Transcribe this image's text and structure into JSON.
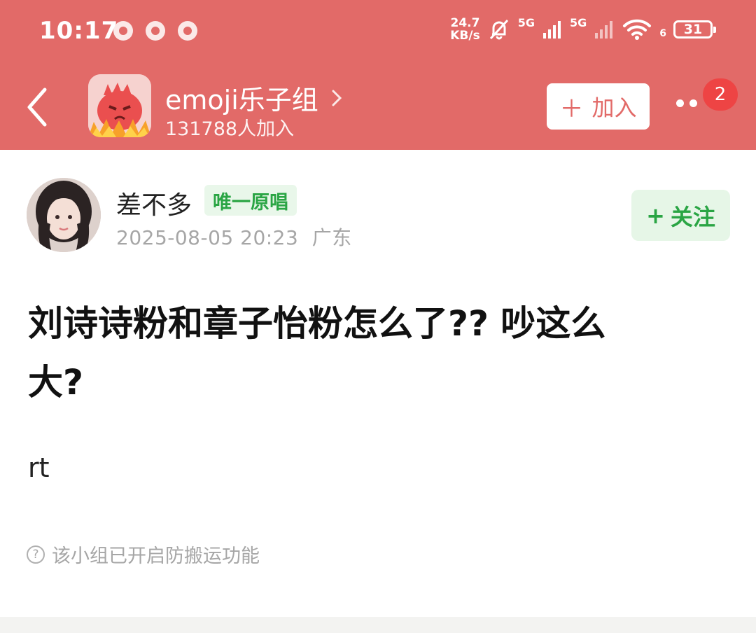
{
  "status_bar": {
    "time": "10:17",
    "net_speed_value": "24.7",
    "net_speed_unit": "KB/s",
    "sim1_label": "5G",
    "sim2_label": "5G",
    "wifi_label": "6",
    "battery": "31"
  },
  "group": {
    "name": "emoji乐子组",
    "members": "131788人加入",
    "join_label": "加入",
    "notification_count": "2"
  },
  "post": {
    "author_name": "差不多",
    "author_badge": "唯一原唱",
    "timestamp": "2025-08-05 20:23",
    "location": "广东",
    "follow_label": "关注",
    "title_line1": "刘诗诗粉和章子怡粉怎么了?? 吵这么",
    "title_line2": "大?",
    "body": "rt",
    "notice": "该小组已开启防搬运功能"
  },
  "colors": {
    "header_bg": "#e26a68",
    "accent_green": "#2aa544",
    "badge_red": "#ee4444"
  },
  "icons": [
    "back-arrow-icon",
    "chevron-right-icon",
    "plus-icon",
    "more-dots-icon",
    "question-circle-icon",
    "mute-bell-icon",
    "signal-icon",
    "wifi-icon",
    "battery-icon"
  ]
}
